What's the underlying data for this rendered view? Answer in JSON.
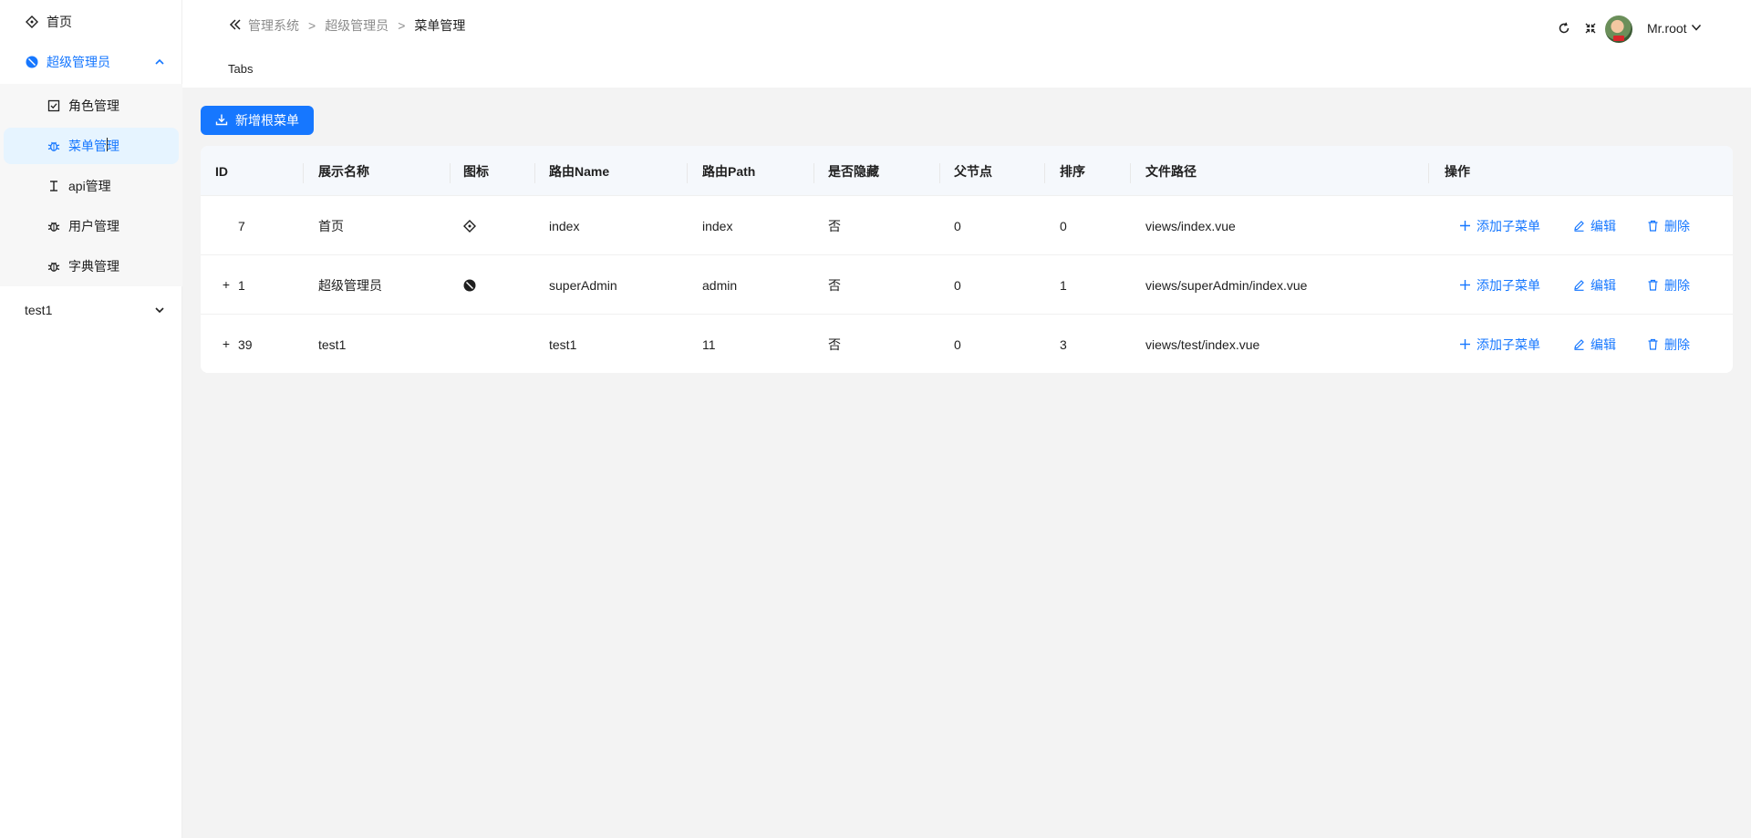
{
  "sidebar": {
    "items": [
      {
        "label": "首页",
        "icon": "compass-icon"
      },
      {
        "label": "超级管理员",
        "icon": "circle-slash-icon",
        "expanded": true,
        "children": [
          {
            "label": "角色管理",
            "icon": "checkbox-icon"
          },
          {
            "label": "菜单管理",
            "icon": "bug-icon",
            "selected": true
          },
          {
            "label": "api管理",
            "icon": "text-cursor-icon"
          },
          {
            "label": "用户管理",
            "icon": "bug-icon"
          },
          {
            "label": "字典管理",
            "icon": "bug-icon"
          }
        ]
      },
      {
        "label": "test1",
        "icon": "",
        "expanded": false
      }
    ]
  },
  "header": {
    "breadcrumb": [
      "管理系统",
      "超级管理员",
      "菜单管理"
    ],
    "separator": ">",
    "tabs_label": "Tabs",
    "username": "Mr.root"
  },
  "toolbar": {
    "add_root_label": "新增根菜单"
  },
  "table": {
    "columns": [
      "ID",
      "展示名称",
      "图标",
      "路由Name",
      "路由Path",
      "是否隐藏",
      "父节点",
      "排序",
      "文件路径",
      "操作"
    ],
    "rows": [
      {
        "expandable": false,
        "id": "7",
        "display_name": "首页",
        "icon": "compass-icon",
        "route_name": "index",
        "route_path": "index",
        "hidden": "否",
        "parent": "0",
        "sort": "0",
        "file_path": "views/index.vue"
      },
      {
        "expandable": true,
        "id": "1",
        "display_name": "超级管理员",
        "icon": "circle-slash-icon",
        "route_name": "superAdmin",
        "route_path": "admin",
        "hidden": "否",
        "parent": "0",
        "sort": "1",
        "file_path": "views/superAdmin/index.vue"
      },
      {
        "expandable": true,
        "id": "39",
        "display_name": "test1",
        "icon": "",
        "route_name": "test1",
        "route_path": "11",
        "hidden": "否",
        "parent": "0",
        "sort": "3",
        "file_path": "views/test/index.vue"
      }
    ],
    "actions": {
      "add_child": "添加子菜单",
      "edit": "编辑",
      "delete": "删除"
    },
    "expand_symbol": "+"
  },
  "colors": {
    "accent": "#1677ff",
    "selected_bg": "#e6f4ff",
    "page_bg": "#f3f3f3"
  }
}
